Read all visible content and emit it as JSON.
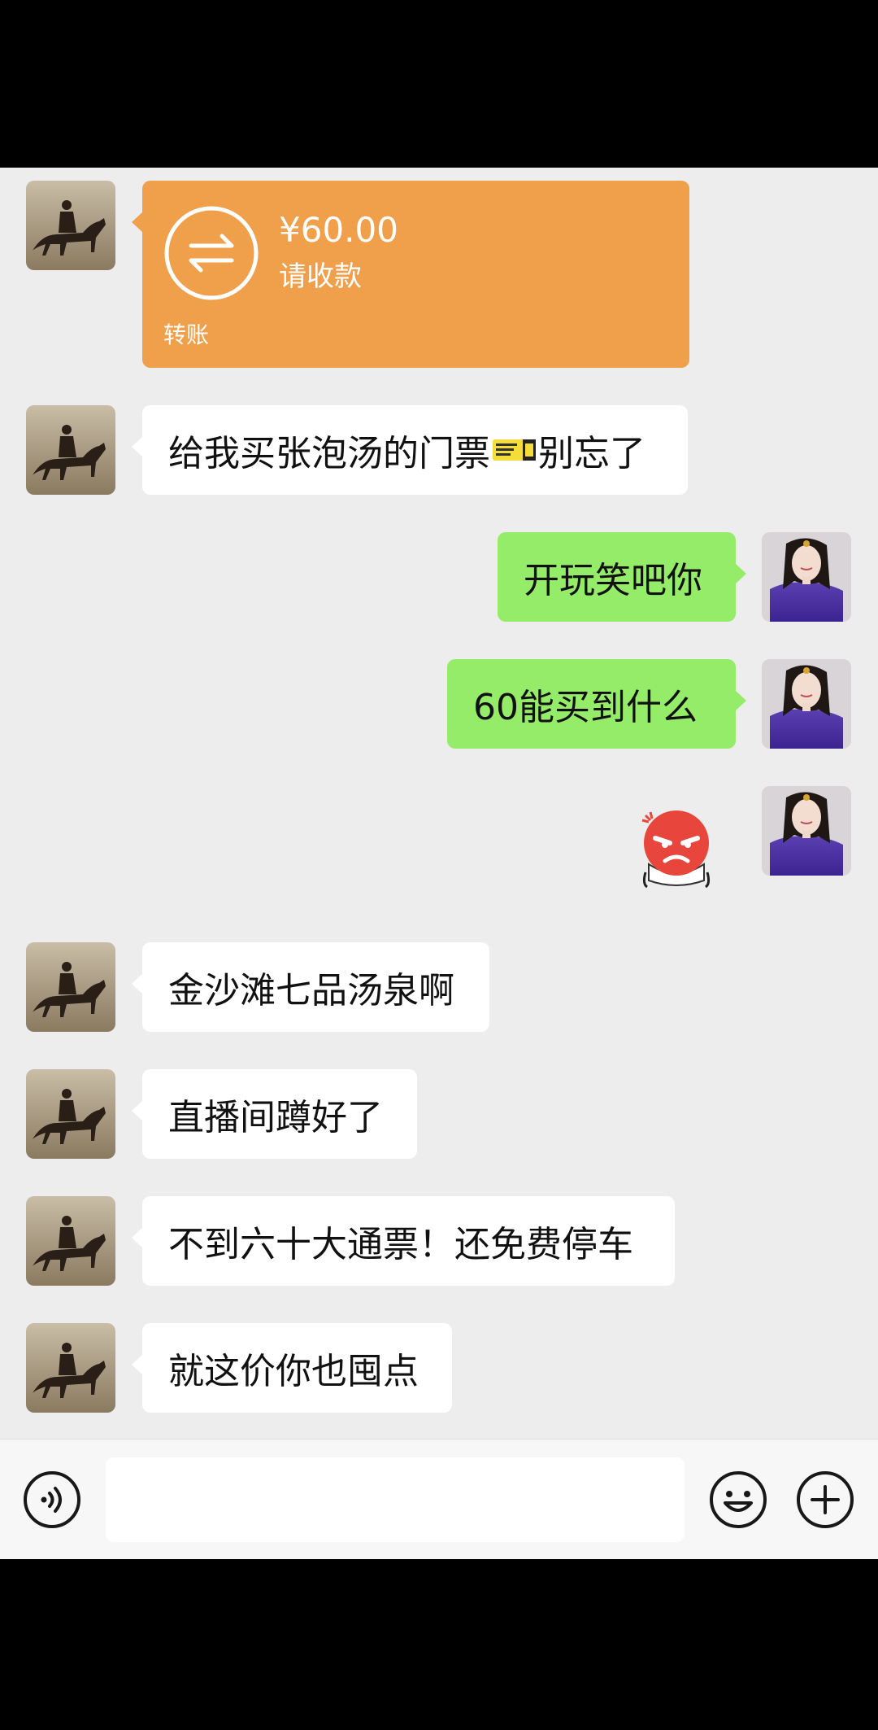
{
  "colors": {
    "chat_background": "#ededed",
    "incoming_bubble": "#ffffff",
    "outgoing_bubble": "#95ec69",
    "transfer_card": "#f0a04b"
  },
  "transfer": {
    "amount": "¥60.00",
    "status": "请收款",
    "label": "转账",
    "icon": "transfer-arrows-icon"
  },
  "messages": [
    {
      "from": "friend",
      "text_before": "给我买张泡汤的门票",
      "emoji": "concert-ticket-emoji",
      "text_after": "别忘了"
    },
    {
      "from": "me",
      "text": "开玩笑吧你"
    },
    {
      "from": "me",
      "text": "60能买到什么"
    },
    {
      "from": "me",
      "sticker": "angry-face-sticker"
    },
    {
      "from": "friend",
      "text": "金沙滩七品汤泉啊"
    },
    {
      "from": "friend",
      "text": "直播间蹲好了"
    },
    {
      "from": "friend",
      "text": "不到六十大通票！还免费停车"
    },
    {
      "from": "friend",
      "text": "就这价你也囤点"
    }
  ],
  "input_bar": {
    "voice_icon": "voice-icon",
    "text_value": "",
    "emoji_icon": "emoji-icon",
    "add_icon": "plus-icon"
  }
}
